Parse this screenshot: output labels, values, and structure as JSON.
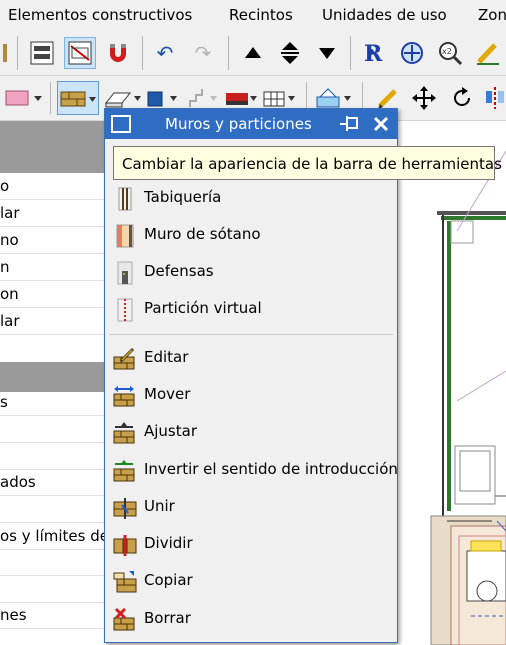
{
  "menubar": {
    "items": [
      "Elementos constructivos",
      "Recintos",
      "Unidades de uso",
      "Zon"
    ]
  },
  "left_panel": {
    "rows": [
      "o",
      "lar",
      "no",
      "n",
      "on",
      "lar",
      "s",
      "ados",
      "os y límites de",
      "nes"
    ]
  },
  "floating_toolbar": {
    "title": "Muros y particiones",
    "tooltip": "Cambiar la apariencia de la barra de herramientas",
    "group1": [
      {
        "label": "Tabiquería",
        "icon": "tabiqueria-icon"
      },
      {
        "label": "Muro de sótano",
        "icon": "muro-sotano-icon"
      },
      {
        "label": "Defensas",
        "icon": "defensas-icon"
      },
      {
        "label": "Partición virtual",
        "icon": "particion-virtual-icon"
      }
    ],
    "group2": [
      {
        "label": "Editar",
        "icon": "editar-icon"
      },
      {
        "label": "Mover",
        "icon": "mover-icon"
      },
      {
        "label": "Ajustar",
        "icon": "ajustar-icon"
      },
      {
        "label": "Invertir el sentido de introducción",
        "icon": "invertir-icon"
      },
      {
        "label": "Unir",
        "icon": "unir-icon"
      },
      {
        "label": "Dividir",
        "icon": "dividir-icon"
      },
      {
        "label": "Copiar",
        "icon": "copiar-icon"
      },
      {
        "label": "Borrar",
        "icon": "borrar-icon"
      }
    ]
  },
  "colors": {
    "title_bar": "#2f6dc3",
    "tooltip_bg": "#ffffe1",
    "brick": "#c8a04a",
    "wall_outline": "#2d7a2d"
  }
}
